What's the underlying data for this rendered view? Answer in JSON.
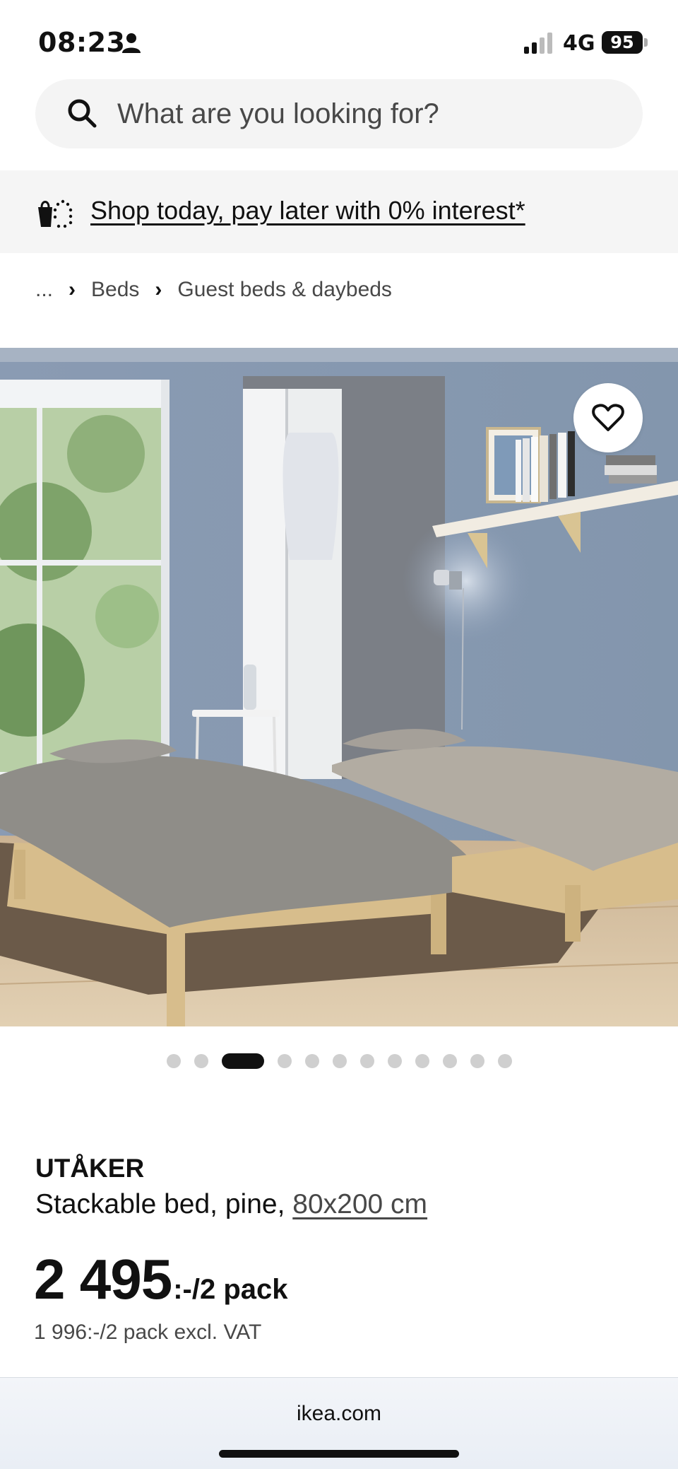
{
  "status_bar": {
    "time": "08:23",
    "network": "4G",
    "battery": "95"
  },
  "search": {
    "placeholder": "What are you looking for?"
  },
  "promo": {
    "text": "Shop today, pay later with 0% interest*"
  },
  "breadcrumb": {
    "items": [
      "...",
      "Beds",
      "Guest beds & daybeds"
    ]
  },
  "carousel": {
    "total": 12,
    "active_index": 2
  },
  "product": {
    "name": "UTÅKER",
    "description": "Stackable bed, pine,",
    "size": "80x200 cm",
    "price": "2 495",
    "price_suffix": ":-/2 pack",
    "price_excl_vat": "1 996:-/2 pack excl. VAT"
  },
  "browser": {
    "url": "ikea.com"
  },
  "icons": {
    "search": "search-icon",
    "promo": "shopping-bag-icon",
    "favorite": "heart-icon",
    "person": "person-icon"
  }
}
